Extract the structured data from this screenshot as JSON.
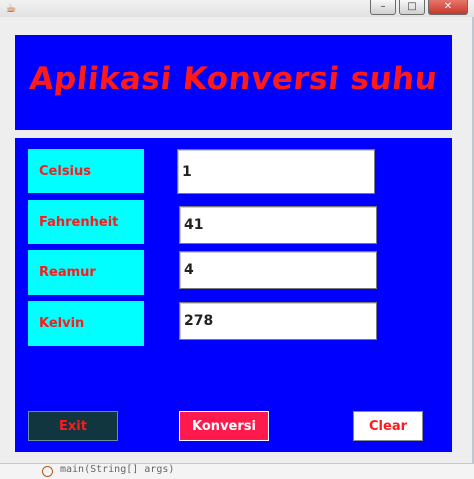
{
  "window": {
    "app_icon": "java-cup-icon",
    "minimize": "–",
    "maximize": "□",
    "close": "✕"
  },
  "header": {
    "title": "Aplikasi Konversi suhu"
  },
  "form": {
    "celsius": {
      "label": "Celsius",
      "value": "1"
    },
    "fahrenheit": {
      "label": "Fahrenheit",
      "value": "41"
    },
    "reamur": {
      "label": "Reamur",
      "value": "4"
    },
    "kelvin": {
      "label": "Kelvin",
      "value": "278"
    }
  },
  "buttons": {
    "exit": "Exit",
    "konversi": "Konversi",
    "clear": "Clear"
  },
  "background_code": {
    "text": "main(String[] args)"
  },
  "colors": {
    "panel": "#0000ff",
    "label_bg": "#00ffff",
    "accent_text": "#ff1a1a"
  }
}
